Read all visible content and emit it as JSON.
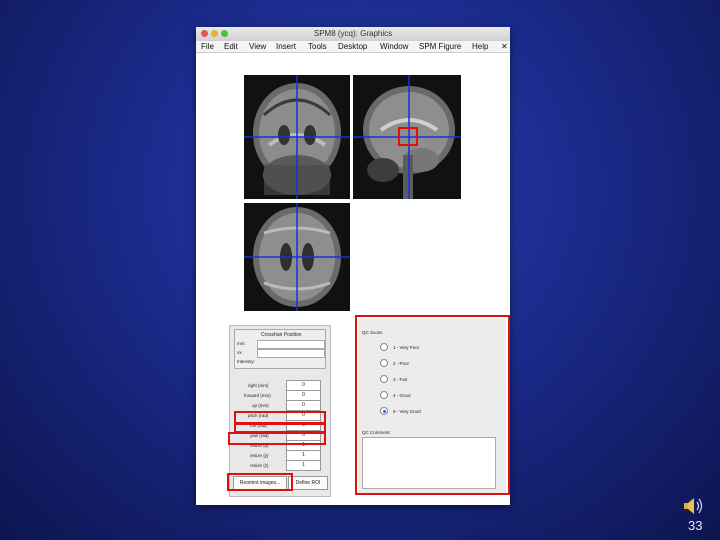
{
  "window": {
    "title": "SPM8 (ycq): Graphics",
    "menu": [
      "File",
      "Edit",
      "View",
      "Insert",
      "Tools",
      "Desktop",
      "Window",
      "SPM Figure",
      "Help"
    ],
    "close_symbol": "✕"
  },
  "coord_panel": {
    "header": "Crosshair Position",
    "mm_label": "mm:",
    "vx_label": "vx:",
    "intensity_label": "Intensity:",
    "params": [
      {
        "label": "right {mm}",
        "value": "0"
      },
      {
        "label": "forward {mm}",
        "value": "0"
      },
      {
        "label": "up {mm}",
        "value": "0"
      },
      {
        "label": "pitch {rad}",
        "value": "0"
      },
      {
        "label": "roll {rad}",
        "value": "0"
      },
      {
        "label": "yaw {rad}",
        "value": "0"
      },
      {
        "label": "resize {x}",
        "value": "1"
      },
      {
        "label": "resize {y}",
        "value": "1"
      },
      {
        "label": "resize {z}",
        "value": "1"
      }
    ],
    "reorient_button": "Reorient images...",
    "define_roi_button": "Define ROI"
  },
  "qc_panel": {
    "score_label": "QC Score:",
    "options": [
      "1 - Very Poor",
      "2 - Poor",
      "3 - Fair",
      "4 - Good",
      "5 - Very Good"
    ],
    "selected_index": 4,
    "comment_label": "QC Comment:"
  },
  "slide": {
    "number": "33",
    "speaker_icon": "speaker-icon"
  },
  "colors": {
    "highlight": "#d11111",
    "crosshair": "#1530e0",
    "background": "#1a2a8a"
  }
}
